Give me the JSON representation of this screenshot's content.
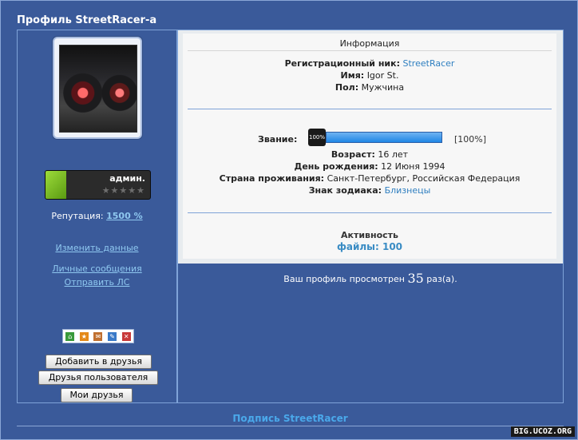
{
  "header": {
    "title": "Профиль StreetRacer-а"
  },
  "left": {
    "rank": {
      "label": "админ.",
      "stars": "★★★★★"
    },
    "reputation": {
      "label": "Репутация:",
      "value": "1500 %"
    },
    "links": {
      "edit": "Изменить данные",
      "messages": "Личные сообщения",
      "send_pm": "Отправить ЛС"
    },
    "buttons": {
      "add_friend": "Добавить в друзья",
      "user_friends": "Друзья пользователя",
      "my_friends": "Мои друзья"
    }
  },
  "info": {
    "section_title": "Информация",
    "reg_nick": {
      "label": "Регистрационный ник:",
      "value": "StreetRacer"
    },
    "name": {
      "label": "Имя:",
      "value": "Igor St."
    },
    "gender": {
      "label": "Пол:",
      "value": "Мужчина"
    },
    "rank": {
      "label": "Звание:",
      "icon_text": "100%",
      "percent": 100,
      "percent_text": "[100%]"
    },
    "age": {
      "label": "Возраст:",
      "value": "16 лет"
    },
    "birthday": {
      "label": "День рождения:",
      "value": "12 Июня 1994"
    },
    "country": {
      "label": "Страна проживания:",
      "value": "Санкт-Петербург, Российская Федерация"
    },
    "zodiac": {
      "label": "Знак зодиака:",
      "value": "Близнецы"
    },
    "activity": {
      "title": "Активность",
      "files": "файлы: 100"
    }
  },
  "views": {
    "prefix": "Ваш профиль просмотрен",
    "count": "35",
    "suffix": "раз(а)."
  },
  "signature": {
    "title": "Подпись StreetRacer"
  },
  "watermark": {
    "text": "BIG.UCOZ.ORG"
  },
  "colors": {
    "background": "#3a5a9a",
    "link": "#8fc8f0",
    "accent": "#2f7fc0"
  }
}
